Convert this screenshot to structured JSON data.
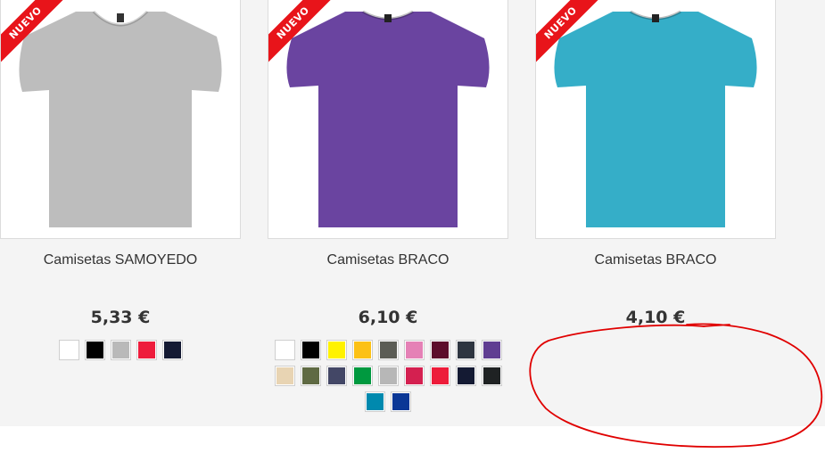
{
  "products": [
    {
      "badge": "NUEVO",
      "title": "Camisetas SAMOYEDO",
      "price": "5,33 €",
      "shirt_color": "#bdbdbd",
      "swatches": [
        "#ffffff",
        "#000000",
        "#b9b9b9",
        "#ee1c3c",
        "#141a33"
      ]
    },
    {
      "badge": "NUEVO",
      "title": "Camisetas BRACO",
      "price": "6,10 €",
      "shirt_color": "#6a44a0",
      "swatches": [
        "#ffffff",
        "#000000",
        "#fff200",
        "#fcc116",
        "#5b5c55",
        "#e581b6",
        "#5c0d2b",
        "#2e3540",
        "#603e92",
        "#e8d4b3",
        "#5f6a43",
        "#434766",
        "#00993f",
        "#b7b7b7",
        "#d42050",
        "#ed1c3a",
        "#141a33",
        "#1f2223",
        "#0089ae",
        "#0a3796"
      ]
    },
    {
      "badge": "NUEVO",
      "title": "Camisetas BRACO",
      "price": "4,10 €",
      "shirt_color": "#35aec8",
      "swatches": []
    }
  ],
  "annotation": {
    "color": "#e00000"
  }
}
